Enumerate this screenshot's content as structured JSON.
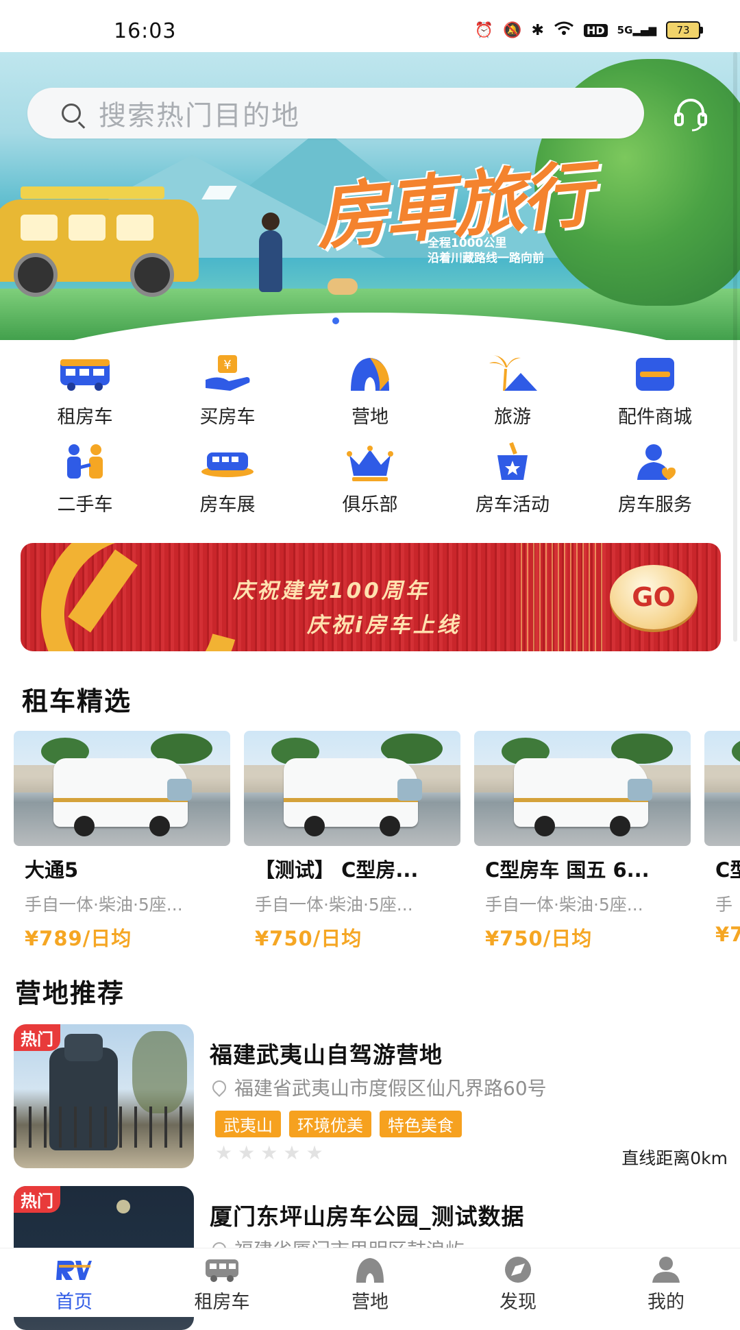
{
  "status": {
    "time": "16:03",
    "battery": "73",
    "network": "5G",
    "hd": "HD"
  },
  "search": {
    "placeholder": "搜索热门目的地"
  },
  "hero": {
    "title": "房車旅行",
    "subtitle1": "全程1000公里",
    "subtitle2": "沿着川藏路线一路向前"
  },
  "categories": [
    {
      "label": "租房车",
      "icon": "rv-rental-icon"
    },
    {
      "label": "买房车",
      "icon": "buy-rv-icon"
    },
    {
      "label": "营地",
      "icon": "camp-icon"
    },
    {
      "label": "旅游",
      "icon": "travel-icon"
    },
    {
      "label": "配件商城",
      "icon": "parts-store-icon"
    },
    {
      "label": "二手车",
      "icon": "used-car-icon"
    },
    {
      "label": "房车展",
      "icon": "rv-show-icon"
    },
    {
      "label": "俱乐部",
      "icon": "club-crown-icon"
    },
    {
      "label": "房车活动",
      "icon": "rv-event-icon"
    },
    {
      "label": "房车服务",
      "icon": "rv-service-icon"
    }
  ],
  "promo": {
    "line1": "庆祝建党100周年",
    "line2": "庆祝i房车上线",
    "cta": "GO"
  },
  "rental": {
    "title": "租车精选",
    "items": [
      {
        "name": "大通5",
        "spec": "手自一体·柴油·5座...",
        "price": "¥789/日均"
      },
      {
        "name": "【测试】 C型房...",
        "spec": "手自一体·柴油·5座...",
        "price": "¥750/日均"
      },
      {
        "name": "C型房车 国五 6...",
        "spec": "手自一体·柴油·5座...",
        "price": "¥750/日均"
      },
      {
        "name": "C型",
        "spec": "手",
        "price": "¥7"
      }
    ]
  },
  "camps": {
    "title": "营地推荐",
    "items": [
      {
        "badge": "热门",
        "name": "福建武夷山自驾游营地",
        "address": "福建省武夷山市度假区仙凡界路60号",
        "tags": [
          "武夷山",
          "环境优美",
          "特色美食"
        ],
        "rating": 0,
        "distance": "直线距离0km"
      },
      {
        "badge": "热门",
        "name": "厦门东坪山房车公园_测试数据",
        "address": "福建省厦门市思明区鼓浪屿"
      }
    ]
  },
  "tabs": [
    {
      "label": "首页",
      "icon": "home-rv-logo-icon",
      "active": true
    },
    {
      "label": "租房车",
      "icon": "rv-icon"
    },
    {
      "label": "营地",
      "icon": "camp-tent-icon"
    },
    {
      "label": "发现",
      "icon": "compass-icon"
    },
    {
      "label": "我的",
      "icon": "profile-icon"
    }
  ],
  "colors": {
    "accent": "#2f5be6",
    "price": "#f5a623",
    "hot": "#e83a3a",
    "tag": "#f6a11f"
  }
}
